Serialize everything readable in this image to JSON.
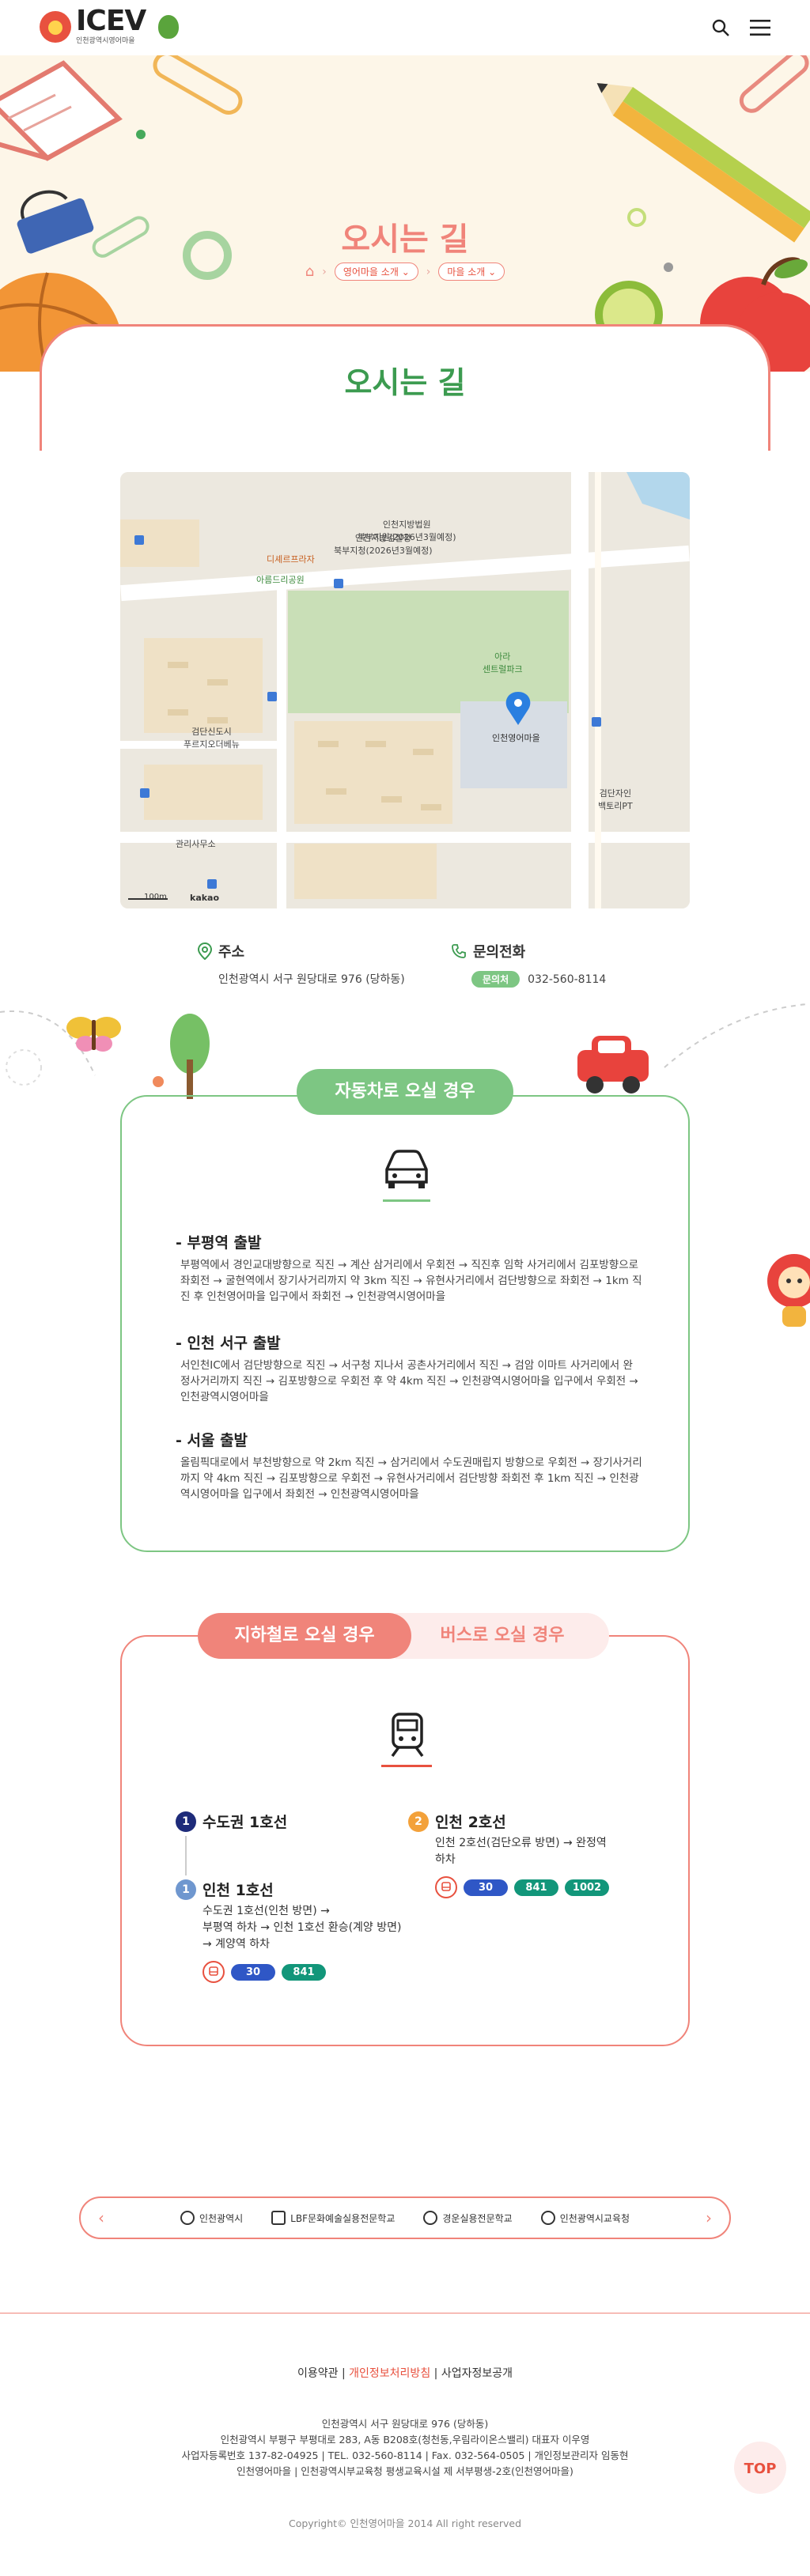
{
  "header": {
    "logo_main": "ICEV",
    "logo_sub": "인천광역시영어마을"
  },
  "hero": {
    "title": "오시는 길",
    "breadcrumb": [
      "영어마을 소개",
      "마을 소개"
    ]
  },
  "page": {
    "title": "오시는 길"
  },
  "map": {
    "labels": {
      "gov": "인천지방법원\n북부지원(2026년3월예정)",
      "gov2": "인천지방검찰청\n북부지청(2026년3월예정)",
      "school1": "디셰르프라자",
      "school2": "아름드리공원",
      "park": "아라\n센트럴파크",
      "village": "인천영어마을",
      "apt": "검단신도시\n푸르지오더베뉴",
      "station": "검단자인\n백토리PT",
      "office": "관리사무소",
      "scale": "100m",
      "kakao": "kakao"
    }
  },
  "contact": {
    "address_label": "주소",
    "address": "인천광역시 서구 원당대로 976 (당하동)",
    "phone_label": "문의전화",
    "phone_badge": "문의처",
    "phone": "032-560-8114"
  },
  "car": {
    "tab": "자동차로 오실 경우",
    "routes": [
      {
        "title": "- 부평역 출발",
        "text": "부평역에서 경인교대방향으로 직진 → 계산 삼거리에서 우회전 → 직진후 임학 사거리에서 김포방향으로 좌회전 → 굴현역에서 장기사거리까지 약 3km 직진 → 유현사거리에서 검단방향으로 좌회전 → 1km 직진 후 인천영어마을 입구에서 좌회전 → 인천광역시영어마을"
      },
      {
        "title": "- 인천 서구 출발",
        "text": "서인천IC에서 검단방향으로 직진 → 서구청 지나서 공촌사거리에서 직진 → 검암 이마트 사거리에서 완정사거리까지 직진 → 김포방향으로 우회전 후 약 4km 직진 → 인천광역시영어마을 입구에서 우회전 → 인천광역시영어마을"
      },
      {
        "title": "- 서울 출발",
        "text": "올림픽대로에서 부천방향으로 약 2km 직진 → 삼거리에서 수도권매립지 방향으로 우회전 → 장기사거리까지 약 4km 직진 → 김포방향으로 우회전 → 유현사거리에서 검단방향 좌회전 후 1km 직진 → 인천광역시영어마을 입구에서 좌회전 → 인천광역시영어마을"
      }
    ]
  },
  "transit": {
    "tab_subway": "지하철로 오실 경우",
    "tab_bus": "버스로 오실 경우",
    "lines": [
      {
        "num": "1",
        "title": "수도권 1호선",
        "color": "#1e2b7a"
      },
      {
        "num": "1",
        "title": "인천 1호선",
        "color": "#6f97cf",
        "desc": "수도권 1호선(인천 방면) →\n부평역 하차 → 인천 1호선 환승(계양 방면)\n→ 계양역 하차",
        "buses": [
          {
            "label": "30",
            "color": "#2f57c6"
          },
          {
            "label": "841",
            "color": "#12967a"
          }
        ]
      },
      {
        "num": "2",
        "title": "인천 2호선",
        "color": "#f3a13a",
        "desc": "인천 2호선(검단오류 방면) → 완정역\n하차",
        "buses": [
          {
            "label": "30",
            "color": "#2f57c6"
          },
          {
            "label": "841",
            "color": "#12967a"
          },
          {
            "label": "1002",
            "color": "#12967a"
          }
        ]
      }
    ]
  },
  "partners": [
    "인천광역시",
    "LBF문화예술실용전문학교",
    "경운실용전문학교",
    "인천광역시교육청"
  ],
  "footer": {
    "links": [
      "이용약관",
      "개인정보처리방침",
      "사업자정보공개"
    ],
    "info": [
      "인천광역시 서구 원당대로 976 (당하동)",
      "인천광역시 부평구 부평대로 283, A동 B208호(청천동,우림라이온스밸리) 대표자 이우영",
      "사업자등록번호 137-82-04925 | TEL. 032-560-8114 | Fax. 032-564-0505 | 개인정보관리자 임동현",
      "인천영어마을 | 인천광역시부교육청 평생교육시설 제 서부평생-2호(인천영어마을)"
    ],
    "copyright": "Copyright© 인천영어마을 2014 All right reserved",
    "top": "TOP"
  }
}
